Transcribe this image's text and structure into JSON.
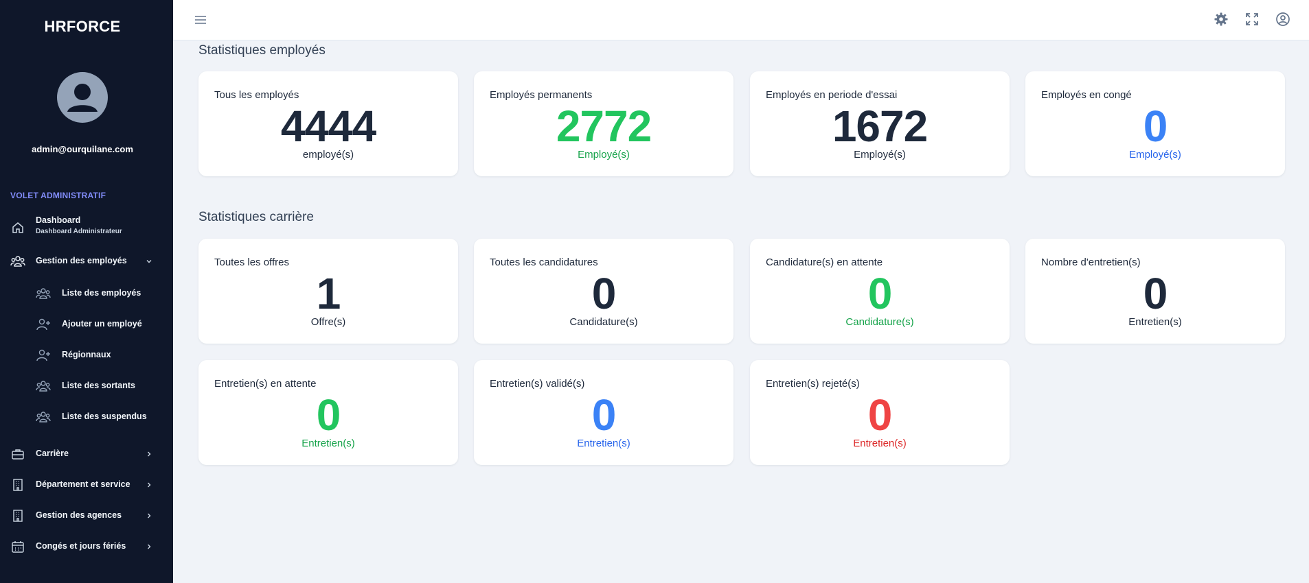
{
  "app": {
    "brand": "HRFORCE",
    "user_email": "admin@ourquilane.com"
  },
  "sidebar": {
    "section_title": "VOLET ADMINISTRATIF",
    "dashboard": {
      "label": "Dashboard",
      "sublabel": "Dashboard Administrateur"
    },
    "employees_group": {
      "label": "Gestion des employés"
    },
    "sub_items": [
      {
        "label": "Liste des employés",
        "icon": "users-icon"
      },
      {
        "label": "Ajouter un employé",
        "icon": "user-plus-icon"
      },
      {
        "label": "Régionnaux",
        "icon": "user-plus-icon"
      },
      {
        "label": "Liste des sortants",
        "icon": "users-icon"
      },
      {
        "label": "Liste des suspendus",
        "icon": "users-icon"
      }
    ],
    "items": [
      {
        "label": "Carrière",
        "icon": "briefcase-icon"
      },
      {
        "label": "Département et service",
        "icon": "building-icon"
      },
      {
        "label": "Gestion des agences",
        "icon": "building-icon"
      },
      {
        "label": "Congés et jours fériés",
        "icon": "calendar-icon"
      }
    ]
  },
  "employees_stats": {
    "heading": "Statistiques employés",
    "cards": [
      {
        "title": "Tous les employés",
        "value": "4444",
        "unit": "employé(s)",
        "color": "#1e293b"
      },
      {
        "title": "Employés permanents",
        "value": "2772",
        "unit": "Employé(s)",
        "color": "#22c55e"
      },
      {
        "title": "Employés en periode d'essai",
        "value": "1672",
        "unit": "Employé(s)",
        "color": "#1e293b"
      },
      {
        "title": "Employés en congé",
        "value": "0",
        "unit": "Employé(s)",
        "color": "#3b82f6"
      }
    ]
  },
  "career_stats": {
    "heading": "Statistiques carrière",
    "cards": [
      {
        "title": "Toutes les offres",
        "value": "1",
        "unit": "Offre(s)",
        "color": "#1e293b"
      },
      {
        "title": "Toutes les candidatures",
        "value": "0",
        "unit": "Candidature(s)",
        "color": "#1e293b"
      },
      {
        "title": "Candidature(s) en attente",
        "value": "0",
        "unit": "Candidature(s)",
        "color": "#22c55e"
      },
      {
        "title": "Nombre d'entretien(s)",
        "value": "0",
        "unit": "Entretien(s)",
        "color": "#1e293b"
      },
      {
        "title": "Entretien(s) en attente",
        "value": "0",
        "unit": "Entretien(s)",
        "color": "#22c55e"
      },
      {
        "title": "Entretien(s) validé(s)",
        "value": "0",
        "unit": "Entretien(s)",
        "color": "#3b82f6"
      },
      {
        "title": "Entretien(s) rejeté(s)",
        "value": "0",
        "unit": "Entretien(s)",
        "color": "#ef4444"
      }
    ]
  },
  "topbar": {
    "icons": [
      "menu-icon",
      "gear-icon",
      "fullscreen-icon",
      "account-icon"
    ]
  }
}
